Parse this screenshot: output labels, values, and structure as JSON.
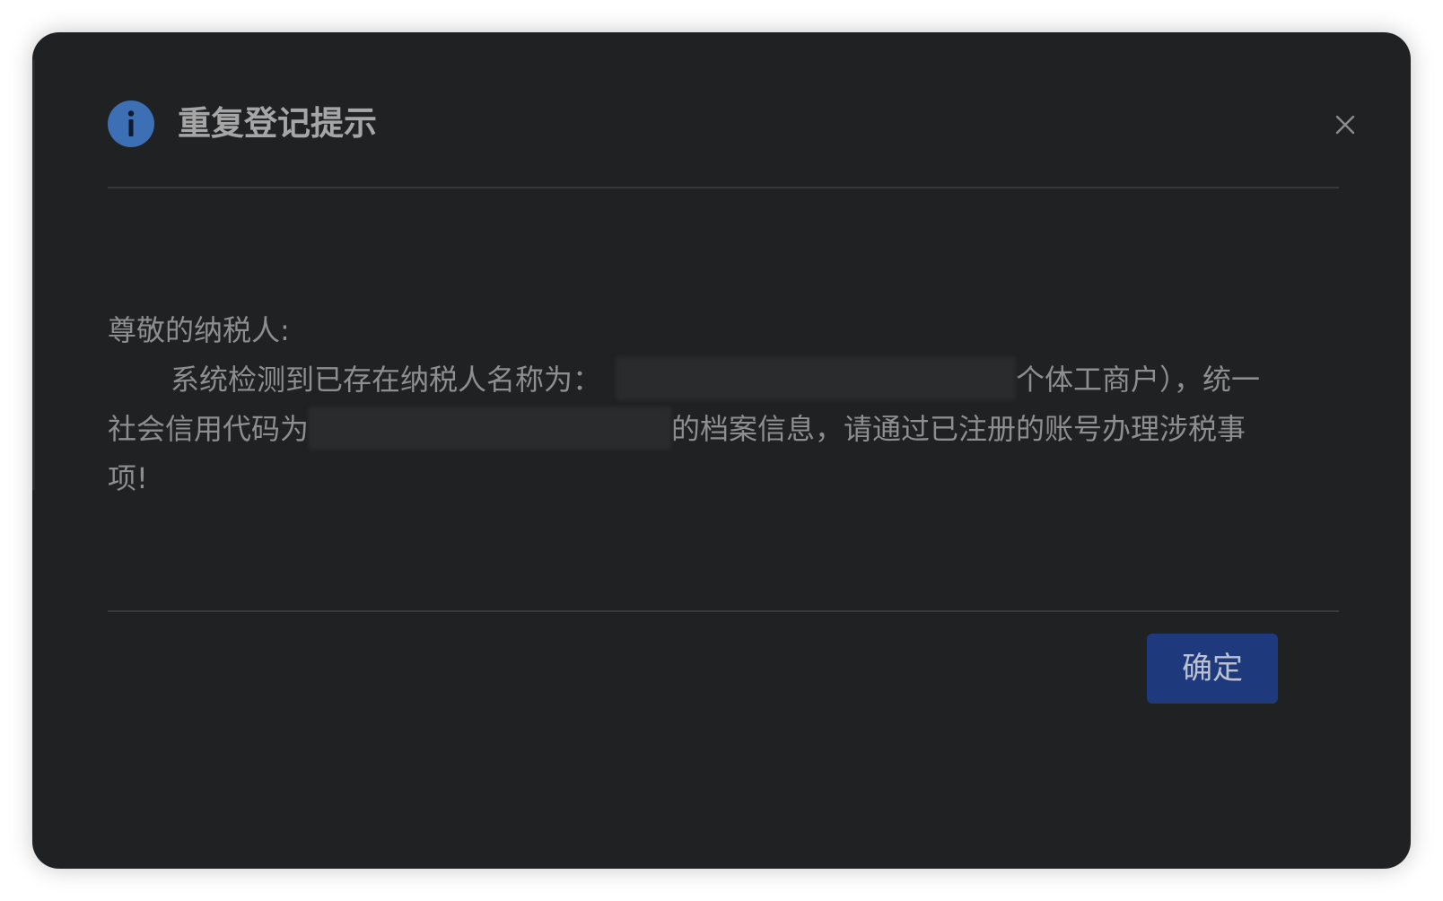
{
  "dialog": {
    "title": "重复登记提示",
    "icons": {
      "header": "info-icon",
      "close": "close-icon"
    },
    "colors": {
      "background": "#202123",
      "title_text": "#a6a6a6",
      "body_text": "#8e8e8e",
      "info_icon": "#3d6fb4",
      "confirm_button": "#1e3a7c"
    }
  },
  "message": {
    "greeting": "尊敬的纳税人:",
    "line2_prefix": "系统检测到已存在纳税人名称为：",
    "line2_suffix": "个体工商户），统一",
    "line3_prefix": "社会信用代码为",
    "line3_suffix": "的档案信息，请通过已注册的账号办理涉税事",
    "line4": "项!"
  },
  "footer": {
    "confirm_label": "确定"
  }
}
